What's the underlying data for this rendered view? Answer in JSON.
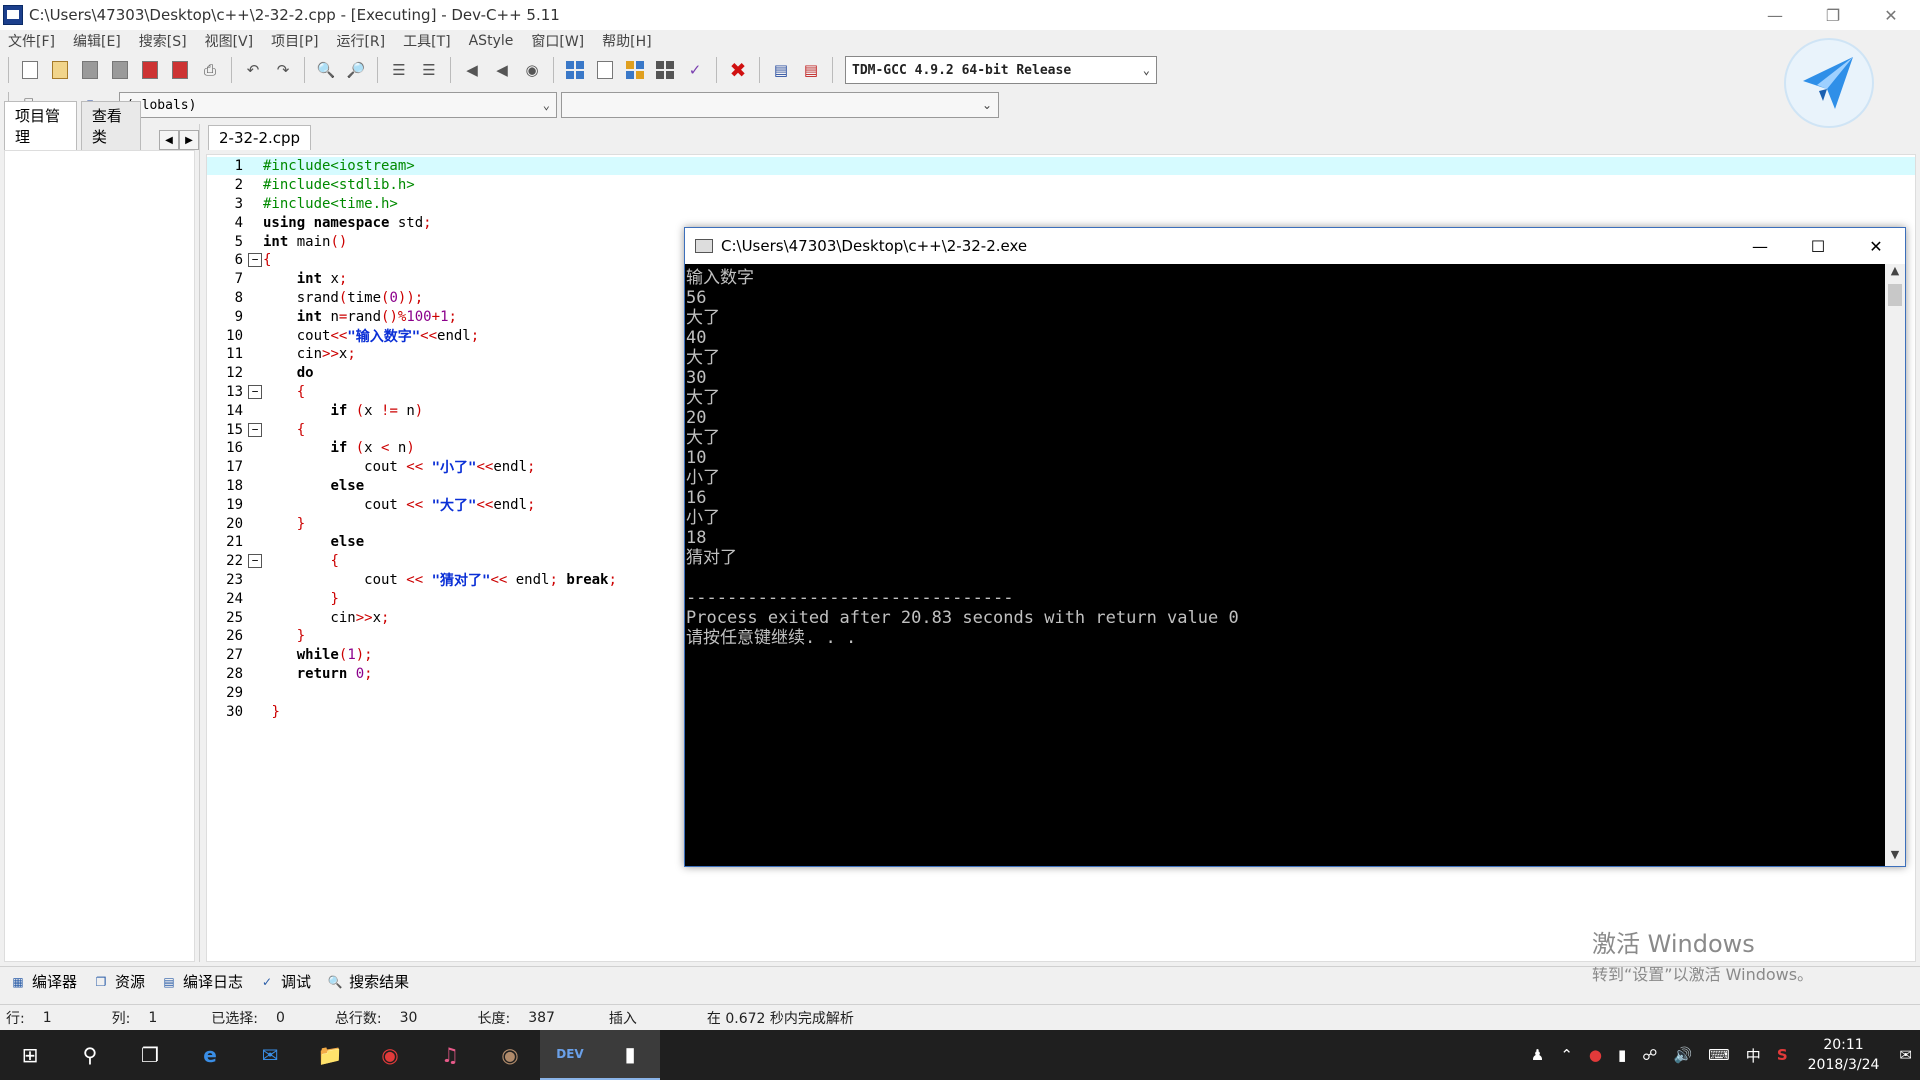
{
  "window": {
    "title": "C:\\Users\\47303\\Desktop\\c++\\2-32-2.cpp - [Executing] - Dev-C++ 5.11"
  },
  "menu": [
    "文件[F]",
    "编辑[E]",
    "搜索[S]",
    "视图[V]",
    "项目[P]",
    "运行[R]",
    "工具[T]",
    "AStyle",
    "窗口[W]",
    "帮助[H]"
  ],
  "toolbar": {
    "compiler": "TDM-GCC 4.9.2 64-bit Release",
    "scope": "(globals)",
    "member": ""
  },
  "left_panel": {
    "tabs": [
      "项目管理",
      "查看类"
    ]
  },
  "editor": {
    "tab": "2-32-2.cpp",
    "lines": [
      "1",
      "2",
      "3",
      "4",
      "5",
      "6",
      "7",
      "8",
      "9",
      "10",
      "11",
      "12",
      "13",
      "14",
      "15",
      "16",
      "17",
      "18",
      "19",
      "20",
      "21",
      "22",
      "23",
      "24",
      "25",
      "26",
      "27",
      "28",
      "29",
      "30"
    ]
  },
  "console": {
    "title": "C:\\Users\\47303\\Desktop\\c++\\2-32-2.exe",
    "output": [
      "输入数字",
      "56",
      "大了",
      "40",
      "大了",
      "30",
      "大了",
      "20",
      "大了",
      "10",
      "小了",
      "16",
      "小了",
      "18",
      "猜对了",
      "",
      "--------------------------------",
      "Process exited after 20.83 seconds with return value 0",
      "请按任意键继续. . ."
    ]
  },
  "bottom_tabs": [
    "编译器",
    "资源",
    "编译日志",
    "调试",
    "搜索结果"
  ],
  "status": {
    "row_label": "行:",
    "row_value": "1",
    "col_label": "列:",
    "col_value": "1",
    "sel_label": "已选择:",
    "sel_value": "0",
    "lines_label": "总行数:",
    "lines_value": "30",
    "len_label": "长度:",
    "len_value": "387",
    "mode": "插入",
    "parse": "在 0.672 秒内完成解析"
  },
  "watermark": {
    "line1": "激活 Windows",
    "line2": "转到“设置”以激活 Windows。"
  },
  "taskbar": {
    "time": "20:11",
    "date": "2018/3/24",
    "ime": "中"
  }
}
